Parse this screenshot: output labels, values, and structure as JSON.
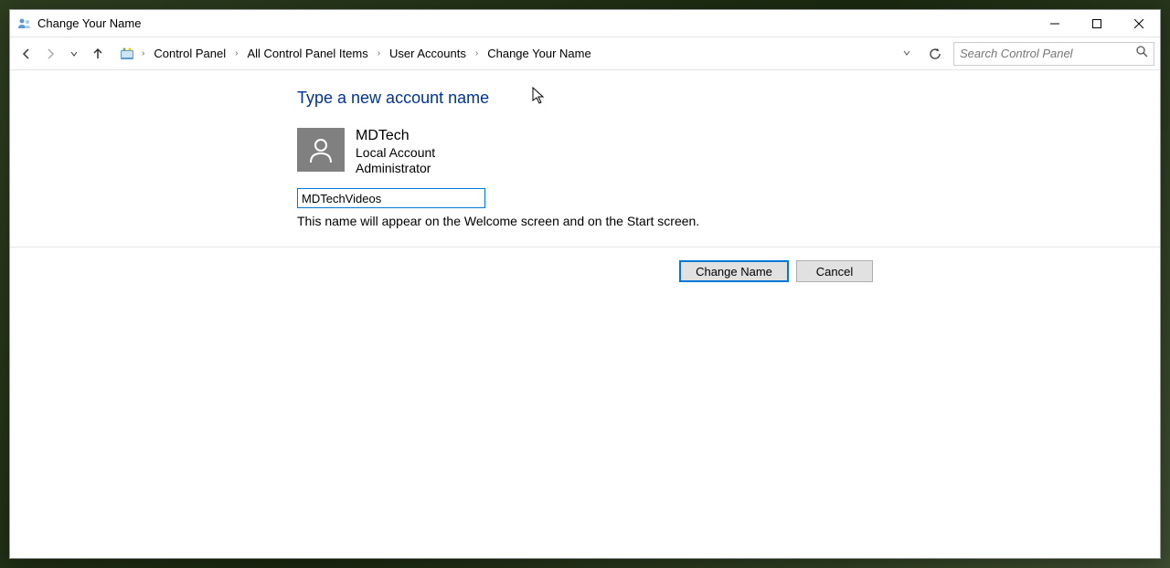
{
  "window": {
    "title": "Change Your Name"
  },
  "breadcrumb": {
    "items": [
      "Control Panel",
      "All Control Panel Items",
      "User Accounts",
      "Change Your Name"
    ]
  },
  "search": {
    "placeholder": "Search Control Panel"
  },
  "content": {
    "heading": "Type a new account name",
    "account_name": "MDTech",
    "account_type": "Local Account",
    "account_role": "Administrator",
    "input_value": "MDTechVideos",
    "help_text": "This name will appear on the Welcome screen and on the Start screen."
  },
  "buttons": {
    "change": "Change Name",
    "cancel": "Cancel"
  }
}
